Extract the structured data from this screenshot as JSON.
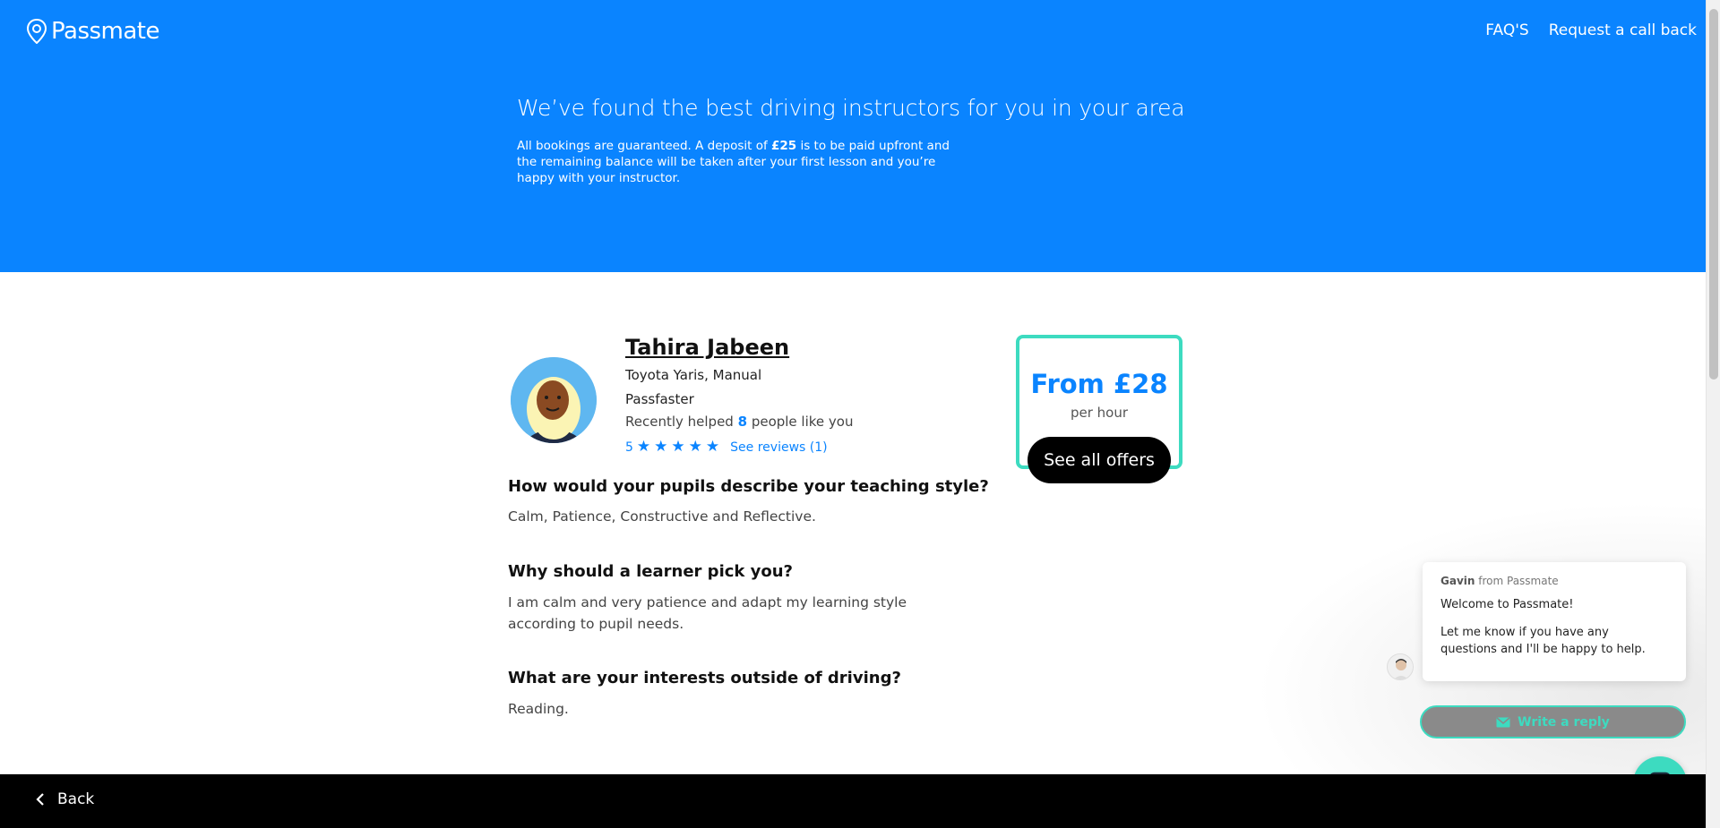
{
  "header": {
    "logo_text": "Passmate",
    "nav": [
      {
        "label": "FAQ'S",
        "icon": "none"
      },
      {
        "label": "Request a call back",
        "icon": "none"
      }
    ],
    "title": "We’ve found the best driving instructors for you in your area",
    "desc_part1": "All bookings are guaranteed. A deposit of ",
    "deposit": "£25",
    "desc_part2": " is to be paid upfront and the remaining balance will be taken after your first lesson and you’re happy with your instructor."
  },
  "instructor": {
    "name": "Tahira Jabeen",
    "car": "Toyota Yaris, Manual",
    "school": "Passfaster",
    "helped_prefix": "Recently helped ",
    "helped_count": "8",
    "helped_suffix": " people like you",
    "rating": "5",
    "star_count": 5,
    "reviews_link": "See reviews (1)"
  },
  "questions": [
    {
      "q": "How would your pupils describe your teaching style?",
      "a": "Calm, Patience, Constructive and Reflective."
    },
    {
      "q": "Why should a learner pick you?",
      "a": "I am calm and very patience and adapt my learning style according to pupil needs."
    },
    {
      "q": "What are your interests outside of driving?",
      "a": "Reading."
    }
  ],
  "price": {
    "from": "From £28",
    "unit": "per hour",
    "button": "See all offers"
  },
  "chat": {
    "agent": "Gavin",
    "from": " from Passmate",
    "greeting": "Welcome to Passmate!",
    "message": "Let me know if you have any questions and I'll be happy to help.",
    "reply_button": "Write a reply"
  },
  "footer": {
    "back_label": "Back"
  },
  "colors": {
    "brand_blue": "#0a84ff",
    "accent_teal": "#3ddbc0",
    "footer_bg": "#000000"
  }
}
